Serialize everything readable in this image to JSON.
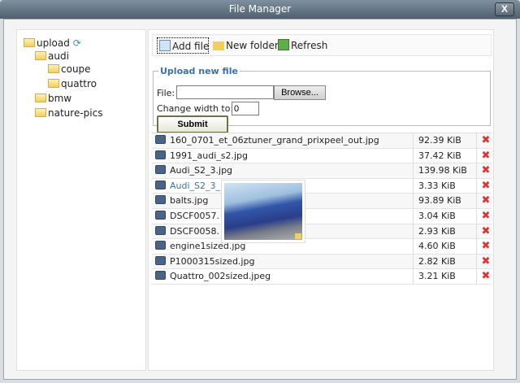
{
  "window": {
    "title": "File Manager",
    "close_label": "X"
  },
  "tree": [
    {
      "label": "upload",
      "depth": 0
    },
    {
      "label": "audi",
      "depth": 1
    },
    {
      "label": "coupe",
      "depth": 2
    },
    {
      "label": "quattro",
      "depth": 2
    },
    {
      "label": "bmw",
      "depth": 1
    },
    {
      "label": "nature-pics",
      "depth": 1
    }
  ],
  "toolbar": {
    "add_file": "Add file",
    "new_folder": "New folder",
    "refresh": "Refresh"
  },
  "upload": {
    "legend": "Upload new file",
    "file_label": "File:",
    "browse": "Browse...",
    "width_label": "Change width to:",
    "width_value": "0",
    "submit": "Submit"
  },
  "files": [
    {
      "name": "160_0701_et_06ztuner_grand_prixpeel_out.jpg",
      "size": "92.39 KiB"
    },
    {
      "name": "1991_audi_s2.jpg",
      "size": "37.42 KiB"
    },
    {
      "name": "Audi_S2_3.jpg",
      "size": "139.98 KiB"
    },
    {
      "name": "Audi_S2_3_",
      "size": "3.33 KiB",
      "hover": true
    },
    {
      "name": "balts.jpg",
      "size": "93.89 KiB"
    },
    {
      "name": "DSCF0057.",
      "size": "3.04 KiB"
    },
    {
      "name": "DSCF0058.",
      "size": "2.93 KiB"
    },
    {
      "name": "engine1sized.jpg",
      "size": "4.60 KiB"
    },
    {
      "name": "P1000315sized.jpg",
      "size": "2.82 KiB"
    },
    {
      "name": "Quattro_002sized.jpeg",
      "size": "3.21 KiB"
    }
  ],
  "delete_icon": "red-x-icon"
}
